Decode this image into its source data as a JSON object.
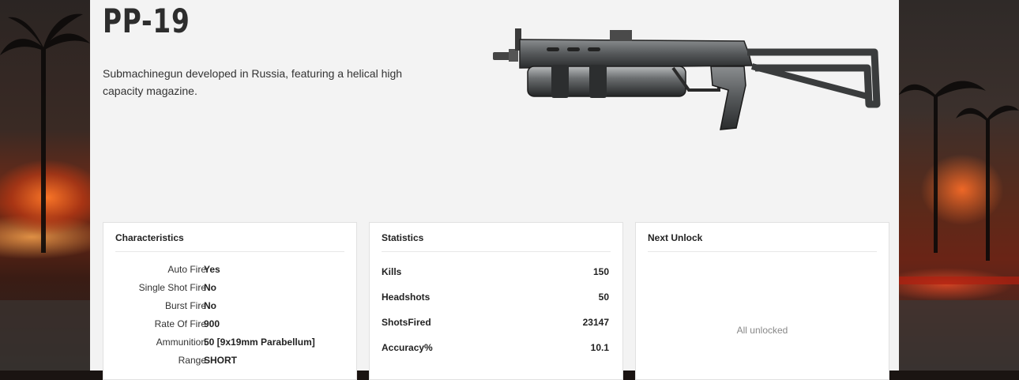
{
  "weapon": {
    "name": "PP-19",
    "description": "Submachinegun developed in Russia, featuring a helical high capacity magazine."
  },
  "characteristics": {
    "title": "Characteristics",
    "rows": [
      {
        "label": "Auto Fire",
        "value": "Yes"
      },
      {
        "label": "Single Shot Fire",
        "value": "No"
      },
      {
        "label": "Burst Fire",
        "value": "No"
      },
      {
        "label": "Rate Of Fire",
        "value": "900"
      },
      {
        "label": "Ammunition",
        "value": "50 [9x19mm Parabellum]"
      },
      {
        "label": "Range",
        "value": "SHORT"
      }
    ]
  },
  "statistics": {
    "title": "Statistics",
    "rows": [
      {
        "label": "Kills",
        "value": "150"
      },
      {
        "label": "Headshots",
        "value": "50"
      },
      {
        "label": "ShotsFired",
        "value": "23147"
      },
      {
        "label": "Accuracy%",
        "value": "10.1"
      }
    ]
  },
  "next_unlock": {
    "title": "Next Unlock",
    "status": "All unlocked"
  },
  "colors": {
    "panel_bg": "#f3f3f3",
    "card_bg": "#ffffff",
    "title_text": "#2d2d2d"
  }
}
